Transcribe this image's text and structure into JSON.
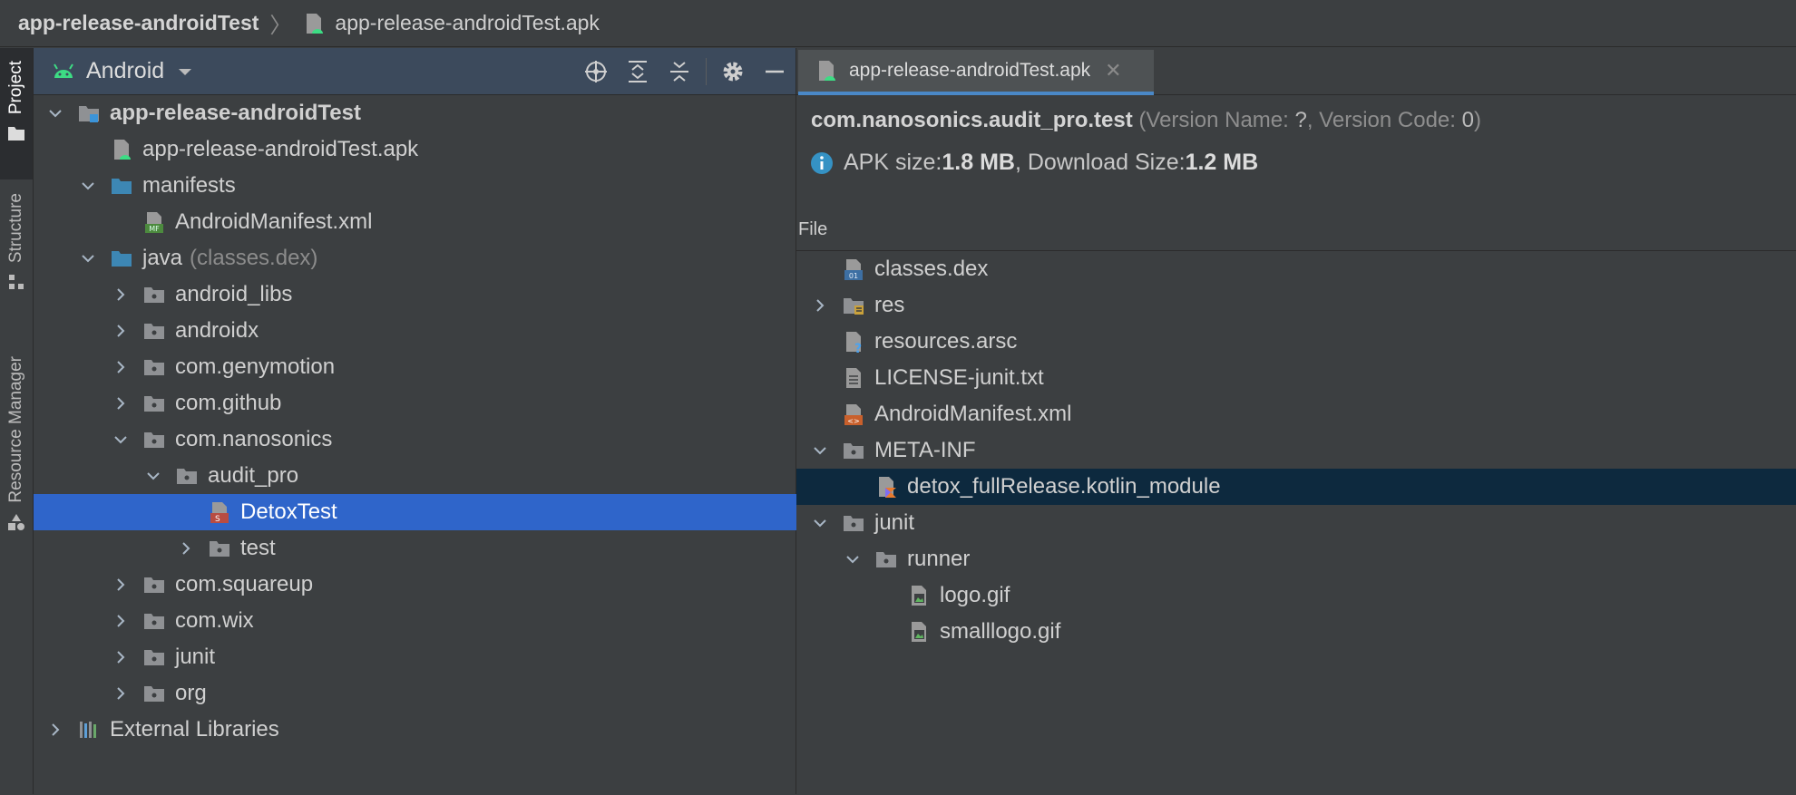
{
  "breadcrumb": {
    "root": "app-release-androidTest",
    "file": "app-release-androidTest.apk"
  },
  "tool_strip": {
    "project": "Project",
    "structure": "Structure",
    "resource_manager": "Resource Manager"
  },
  "project_panel": {
    "view_mode": "Android",
    "tree": [
      {
        "label": "app-release-androidTest",
        "icon": "module-icon",
        "expanded": true
      },
      {
        "label": "app-release-androidTest.apk",
        "icon": "apk-file-icon"
      },
      {
        "label": "manifests",
        "icon": "folder-icon",
        "expanded": true
      },
      {
        "label": "AndroidManifest.xml",
        "icon": "manifest-file-icon"
      },
      {
        "label": "java",
        "muted": "(classes.dex)",
        "icon": "folder-icon",
        "expanded": true
      },
      {
        "label": "android_libs",
        "icon": "package-icon",
        "expanded": false
      },
      {
        "label": "androidx",
        "icon": "package-icon",
        "expanded": false
      },
      {
        "label": "com.genymotion",
        "icon": "package-icon",
        "expanded": false
      },
      {
        "label": "com.github",
        "icon": "package-icon",
        "expanded": false
      },
      {
        "label": "com.nanosonics",
        "icon": "package-icon",
        "expanded": true
      },
      {
        "label": "audit_pro",
        "icon": "package-icon",
        "expanded": true
      },
      {
        "label": "DetoxTest",
        "icon": "smali-file-icon",
        "selected": true
      },
      {
        "label": "test",
        "icon": "package-icon",
        "expanded": false
      },
      {
        "label": "com.squareup",
        "icon": "package-icon",
        "expanded": false
      },
      {
        "label": "com.wix",
        "icon": "package-icon",
        "expanded": false
      },
      {
        "label": "junit",
        "icon": "package-icon",
        "expanded": false
      },
      {
        "label": "org",
        "icon": "package-icon",
        "expanded": false
      },
      {
        "label": "External Libraries",
        "icon": "libraries-icon",
        "expanded": false
      }
    ]
  },
  "editor": {
    "tab_label": "app-release-androidTest.apk",
    "package_name": "com.nanosonics.audit_pro.test",
    "version_name_label": "(Version Name: ",
    "version_name": "?",
    "version_code_label": ", Version Code: ",
    "version_code": "0",
    "version_close": ")",
    "apk_size_label": "APK size: ",
    "apk_size": "1.8 MB",
    "download_size_label": ", Download Size: ",
    "download_size": "1.2 MB",
    "column_header": "File",
    "files": [
      {
        "label": "classes.dex",
        "icon": "dex-file-icon"
      },
      {
        "label": "res",
        "icon": "res-folder-icon",
        "expanded": false
      },
      {
        "label": "resources.arsc",
        "icon": "unknown-file-icon"
      },
      {
        "label": "LICENSE-junit.txt",
        "icon": "text-file-icon"
      },
      {
        "label": "AndroidManifest.xml",
        "icon": "xml-file-icon"
      },
      {
        "label": "META-INF",
        "icon": "folder-icon",
        "expanded": true
      },
      {
        "label": "detox_fullRelease.kotlin_module",
        "icon": "kotlin-file-icon",
        "highlighted": true
      },
      {
        "label": "junit",
        "icon": "folder-icon",
        "expanded": true
      },
      {
        "label": "runner",
        "icon": "folder-icon",
        "expanded": true
      },
      {
        "label": "logo.gif",
        "icon": "image-file-icon"
      },
      {
        "label": "smalllogo.gif",
        "icon": "image-file-icon"
      }
    ]
  },
  "colors": {
    "selection": "#2f65ca",
    "highlight": "#0d293e",
    "folder_blue": "#3d87b4",
    "android_green": "#3ddc84"
  }
}
